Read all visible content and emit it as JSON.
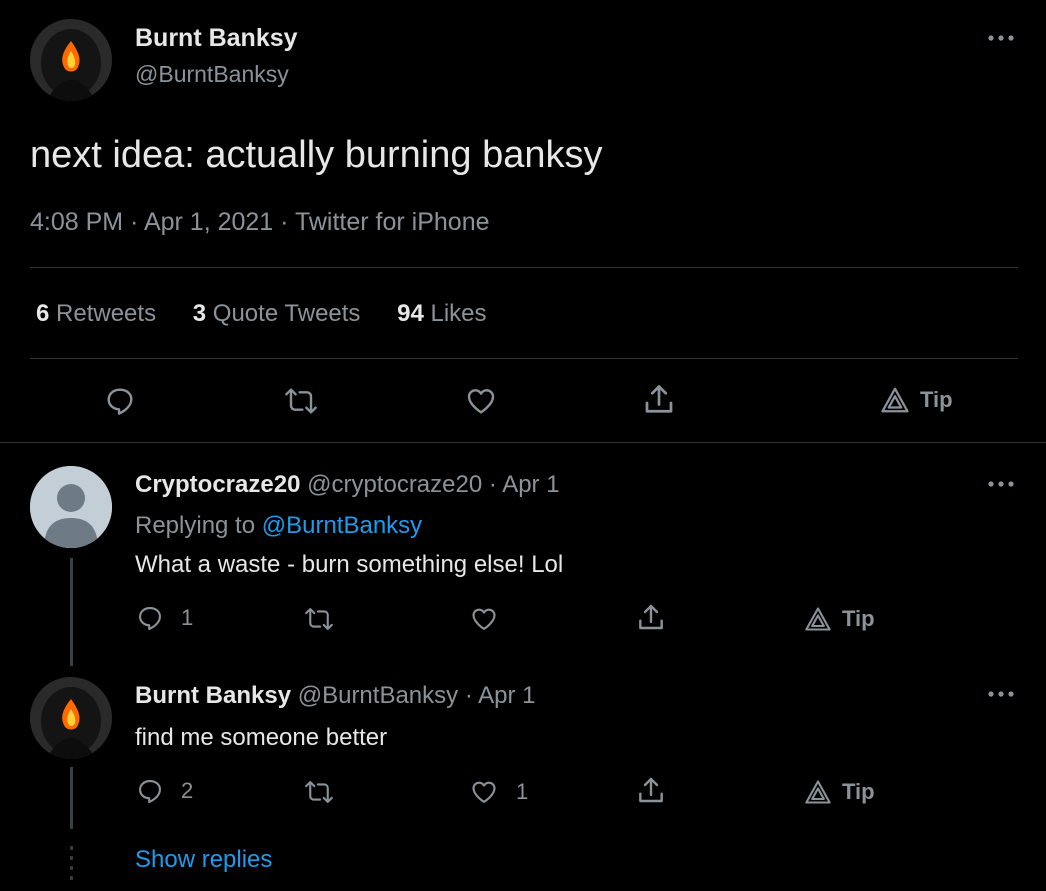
{
  "main_tweet": {
    "display_name": "Burnt Banksy",
    "handle": "@BurntBanksy",
    "text": "next idea: actually burning banksy",
    "timestamp": "4:08 PM · Apr 1, 2021 · Twitter for iPhone",
    "stats": {
      "retweets_count": "6",
      "retweets_label": "Retweets",
      "quotes_count": "3",
      "quotes_label": "Quote Tweets",
      "likes_count": "94",
      "likes_label": "Likes"
    },
    "tip_label": "Tip"
  },
  "replies": [
    {
      "display_name": "Cryptocraze20",
      "meta": "@cryptocraze20 · Apr 1",
      "replying_prefix": "Replying to",
      "replying_handle": "@BurntBanksy",
      "text": "What a waste - burn something else! Lol",
      "reply_count": "1",
      "retweet_count": "",
      "like_count": "",
      "tip_label": "Tip"
    },
    {
      "display_name": "Burnt Banksy",
      "meta": "@BurntBanksy · Apr 1",
      "text": "find me someone better",
      "reply_count": "2",
      "retweet_count": "",
      "like_count": "1",
      "tip_label": "Tip"
    }
  ],
  "show_replies_label": "Show replies",
  "colors": {
    "background": "#000000",
    "text": "#e7e7e7",
    "muted": "#8b939a",
    "link": "#1d9bf0",
    "divider": "#2f3336"
  }
}
